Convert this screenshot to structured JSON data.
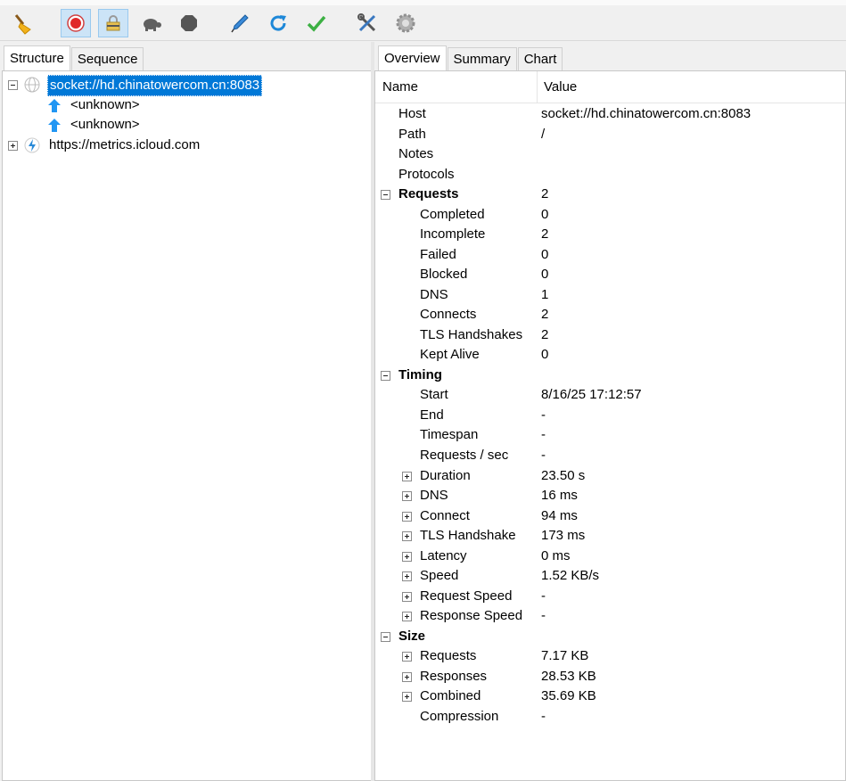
{
  "toolbar": {
    "buttons": [
      {
        "name": "clear-broom-icon",
        "glyph": "🧹"
      },
      {
        "name": "record-icon"
      },
      {
        "name": "ssl-proxy-lock-icon"
      },
      {
        "name": "throttle-turtle-icon"
      },
      {
        "name": "stop-hexagon-icon"
      },
      {
        "name": "compose-pen-icon"
      },
      {
        "name": "repeat-refresh-icon"
      },
      {
        "name": "validate-check-icon"
      },
      {
        "name": "tools-icon"
      },
      {
        "name": "settings-gear-icon"
      }
    ]
  },
  "left": {
    "tabs": [
      "Structure",
      "Sequence"
    ],
    "tree": [
      {
        "label": "socket://hd.chinatowercom.cn:8083",
        "expanded": true,
        "selected": true,
        "children": [
          "<unknown>",
          "<unknown>"
        ]
      },
      {
        "label": "https://metrics.icloud.com",
        "expanded": false
      }
    ]
  },
  "right": {
    "tabs": [
      "Overview",
      "Summary",
      "Chart"
    ],
    "columns": {
      "name": "Name",
      "value": "Value"
    },
    "rows": [
      {
        "name": "Host",
        "value": "socket://hd.chinatowercom.cn:8083",
        "level": 0
      },
      {
        "name": "Path",
        "value": "/",
        "level": 0
      },
      {
        "name": "Notes",
        "value": "",
        "level": 0
      },
      {
        "name": "Protocols",
        "value": "",
        "level": 0
      },
      {
        "name": "Requests",
        "value": "2",
        "level": 0,
        "group": true,
        "toggle": "minus"
      },
      {
        "name": "Completed",
        "value": "0",
        "level": 1
      },
      {
        "name": "Incomplete",
        "value": "2",
        "level": 1
      },
      {
        "name": "Failed",
        "value": "0",
        "level": 1
      },
      {
        "name": "Blocked",
        "value": "0",
        "level": 1
      },
      {
        "name": "DNS",
        "value": "1",
        "level": 1
      },
      {
        "name": "Connects",
        "value": "2",
        "level": 1
      },
      {
        "name": "TLS Handshakes",
        "value": "2",
        "level": 1
      },
      {
        "name": "Kept Alive",
        "value": "0",
        "level": 1
      },
      {
        "name": "Timing",
        "value": "",
        "level": 0,
        "group": true,
        "toggle": "minus"
      },
      {
        "name": "Start",
        "value": "8/16/25 17:12:57",
        "level": 1
      },
      {
        "name": "End",
        "value": "-",
        "level": 1
      },
      {
        "name": "Timespan",
        "value": "-",
        "level": 1
      },
      {
        "name": "Requests / sec",
        "value": "-",
        "level": 1
      },
      {
        "name": "Duration",
        "value": "23.50 s",
        "level": 1,
        "toggle": "plus"
      },
      {
        "name": "DNS",
        "value": "16 ms",
        "level": 1,
        "toggle": "plus"
      },
      {
        "name": "Connect",
        "value": "94 ms",
        "level": 1,
        "toggle": "plus"
      },
      {
        "name": "TLS Handshake",
        "value": "173 ms",
        "level": 1,
        "toggle": "plus"
      },
      {
        "name": "Latency",
        "value": "0 ms",
        "level": 1,
        "toggle": "plus"
      },
      {
        "name": "Speed",
        "value": "1.52 KB/s",
        "level": 1,
        "toggle": "plus"
      },
      {
        "name": "Request Speed",
        "value": "-",
        "level": 1,
        "toggle": "plus"
      },
      {
        "name": "Response Speed",
        "value": "-",
        "level": 1,
        "toggle": "plus"
      },
      {
        "name": "Size",
        "value": "",
        "level": 0,
        "group": true,
        "toggle": "minus"
      },
      {
        "name": "Requests",
        "value": "7.17 KB",
        "level": 1,
        "toggle": "plus"
      },
      {
        "name": "Responses",
        "value": "28.53 KB",
        "level": 1,
        "toggle": "plus"
      },
      {
        "name": "Combined",
        "value": "35.69 KB",
        "level": 1,
        "toggle": "plus"
      },
      {
        "name": "Compression",
        "value": "-",
        "level": 1
      }
    ]
  }
}
